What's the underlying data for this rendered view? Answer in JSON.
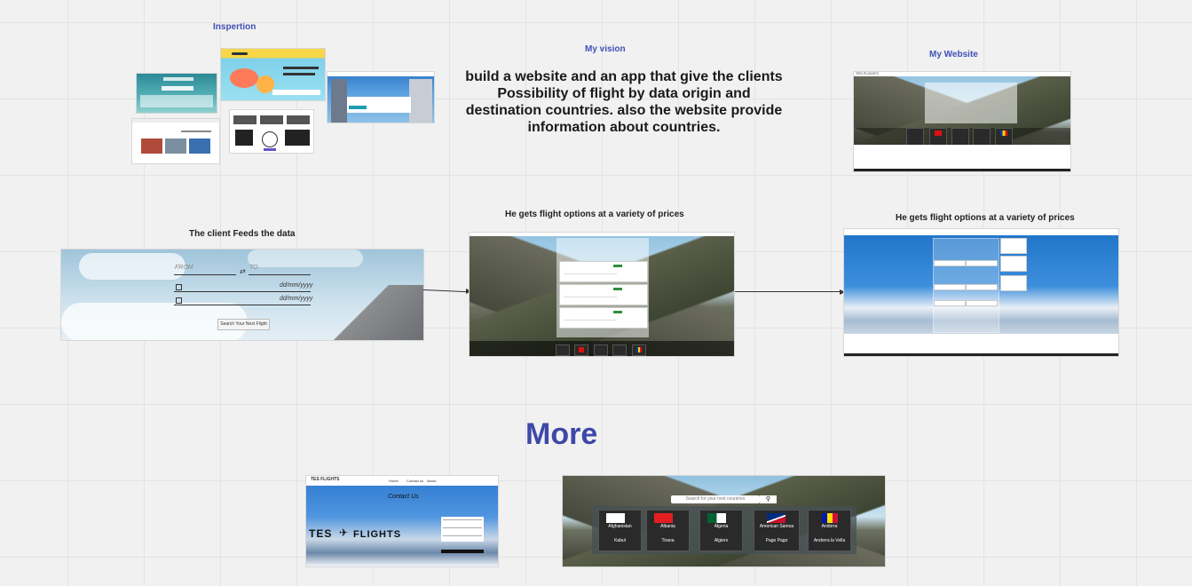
{
  "board": {
    "inspiration_label": "Inspertion",
    "vision_label": "My vision",
    "website_label": "My Website",
    "vision_text": "build a website and an app that give the clients Possibility of flight by data origin and destination countries. also the website provide information about countries.",
    "client_feeds_label": "The client Feeds the data",
    "flight_options_label_1": "He gets flight options at a variety of prices",
    "flight_options_label_2": "He gets flight options at a variety of prices",
    "more_label": "More"
  },
  "search_form": {
    "from_placeholder": "FROM",
    "to_placeholder": "TO",
    "swap_symbol": "⇄",
    "date_placeholder_1": "dd/mm/yyyy",
    "date_placeholder_2": "dd/mm/yyyy",
    "search_button": "Search Your Next Flight"
  },
  "contact": {
    "title": "Contact Us",
    "logo_text_left": "TES",
    "logo_text_right": "FLIGHTS",
    "nav_items": [
      "Home",
      "Contact us",
      "About"
    ],
    "brand": "TES FLIGHTS"
  },
  "countries": {
    "search_placeholder": "Search for your next countries",
    "cards": [
      {
        "name": "Afghanistan",
        "capital": "Kabul"
      },
      {
        "name": "Albania",
        "capital": "Tirana"
      },
      {
        "name": "Algeria",
        "capital": "Algiers"
      },
      {
        "name": "American Samoa",
        "capital": "Pago Pago"
      },
      {
        "name": "Andorra",
        "capital": "Andorra la Vella"
      }
    ]
  },
  "colors": {
    "accent": "#4051b5",
    "more": "#3e48a8"
  }
}
